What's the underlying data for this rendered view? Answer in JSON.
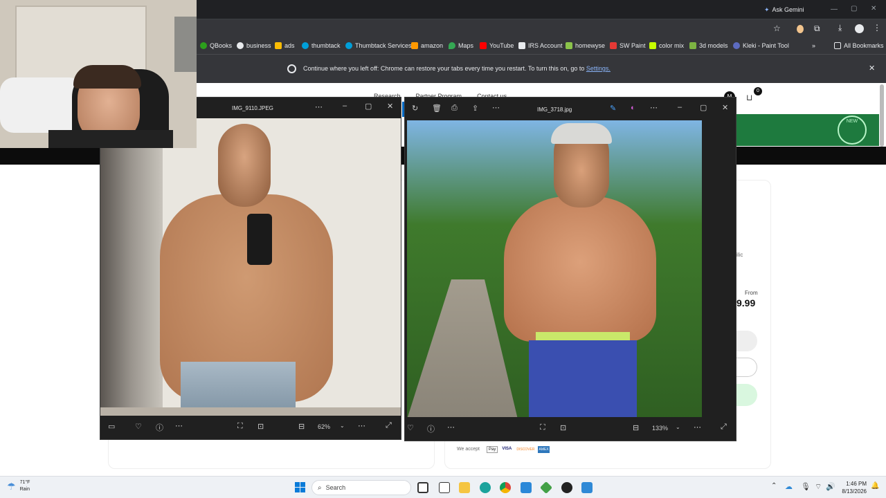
{
  "browser": {
    "ask_gemini": "Ask Gemini",
    "bookmarks": [
      "QBooks",
      "business",
      "ads",
      "thumbtack",
      "Thumbtack Services",
      "amazon",
      "Maps",
      "YouTube",
      "IRS Account",
      "homewyse",
      "SW Paint",
      "color mix",
      "3d models",
      "Kleki - Paint Tool"
    ],
    "all_bookmarks": "All Bookmarks",
    "restore_message": "Continue where you left off: Chrome can restore your tabs every time you restart. To turn this on, go to",
    "restore_link": "Settings."
  },
  "website": {
    "nav": [
      "Research",
      "Partner Program",
      "Contact us"
    ],
    "cart_count": "0",
    "avatar_letter": "M",
    "banner_badge": "NEW",
    "fragment_text": "ilic",
    "price_from": "From",
    "price": "9.99",
    "we_accept": "We accept",
    "payment_methods": [
      "Pay",
      "VISA",
      "DISCOVER",
      "AMEX"
    ]
  },
  "photo_left": {
    "title": "IMG_9110.JPEG",
    "zoom": "62%"
  },
  "photo_right": {
    "title": "IMG_3718.jpg",
    "zoom": "133%"
  },
  "taskbar": {
    "weather_temp": "71°F",
    "weather_cond": "Rain",
    "search": "Search",
    "time": "1:46 PM",
    "date": "8/13/2026"
  },
  "colors": {
    "chrome_bg": "#35363a",
    "banner_green": "#1e7a3e",
    "photos_bg": "#202020",
    "accent_blue": "#0067c0"
  }
}
